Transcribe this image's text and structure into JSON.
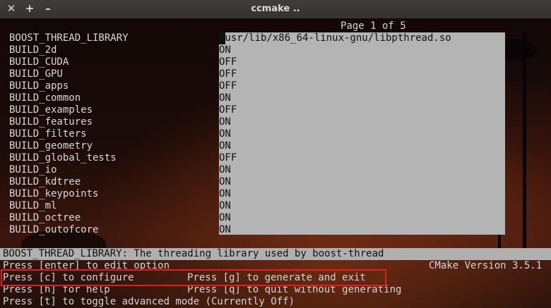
{
  "window": {
    "title": "ccmake .."
  },
  "page_indicator": "Page 1 of 5",
  "variables": [
    {
      "name": "BOOST_THREAD_LIBRARY",
      "value": "/usr/lib/x86_64-linux-gnu/libpthread.so"
    },
    {
      "name": "BUILD_2d",
      "value": "ON"
    },
    {
      "name": "BUILD_CUDA",
      "value": "OFF"
    },
    {
      "name": "BUILD_GPU",
      "value": "OFF"
    },
    {
      "name": "BUILD_apps",
      "value": "OFF"
    },
    {
      "name": "BUILD_common",
      "value": "ON"
    },
    {
      "name": "BUILD_examples",
      "value": "OFF"
    },
    {
      "name": "BUILD_features",
      "value": "ON"
    },
    {
      "name": "BUILD_filters",
      "value": "ON"
    },
    {
      "name": "BUILD_geometry",
      "value": "ON"
    },
    {
      "name": "BUILD_global_tests",
      "value": "OFF"
    },
    {
      "name": "BUILD_io",
      "value": "ON"
    },
    {
      "name": "BUILD_kdtree",
      "value": "ON"
    },
    {
      "name": "BUILD_keypoints",
      "value": "ON"
    },
    {
      "name": "BUILD_ml",
      "value": "ON"
    },
    {
      "name": "BUILD_octree",
      "value": "ON"
    },
    {
      "name": "BUILD_outofcore",
      "value": "ON"
    }
  ],
  "help_description": "BOOST_THREAD_LIBRARY: The threading library used by boost-thread",
  "footer": {
    "edit_option": "Press [enter] to edit option",
    "version": "CMake Version 3.5.1",
    "configure": "Press [c] to configure",
    "generate": "Press [g] to generate and exit",
    "help": "Press [h] for help",
    "quit": "Press [q] to quit without generating",
    "toggle": "Press [t] to toggle advanced mode (Currently Off)"
  },
  "colors": {
    "highlight_box": "#e02020",
    "value_panel": "#b4b4b4",
    "help_bar": "#b0b0b0"
  }
}
